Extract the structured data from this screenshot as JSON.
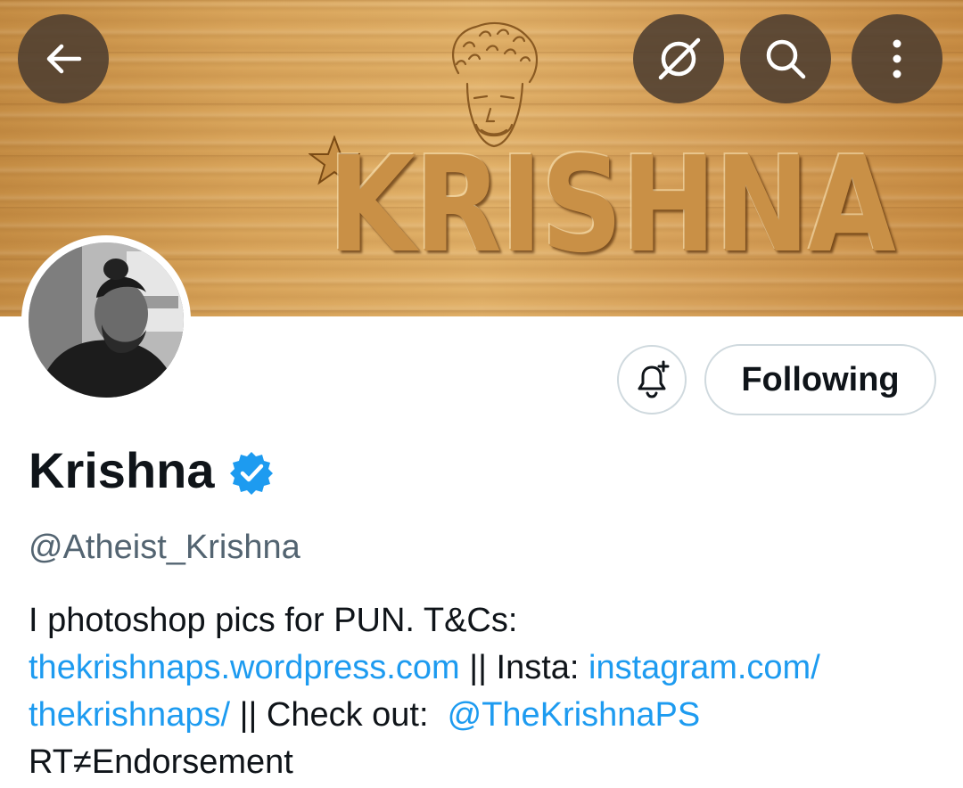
{
  "banner": {
    "word": "KRISHNA",
    "colors": {
      "wood_light": "#e2b26a",
      "wood_dark": "#c58d44"
    }
  },
  "top_buttons": [
    {
      "name": "back-arrow-icon"
    },
    {
      "name": "grok-icon"
    },
    {
      "name": "search-icon"
    },
    {
      "name": "more-vertical-icon"
    }
  ],
  "actions": {
    "notifications_icon": "bell-plus-icon",
    "following_label": "Following"
  },
  "profile": {
    "display_name": "Krishna",
    "verified": true,
    "verified_color": "#1d9bf0",
    "handle": "@Atheist_Krishna"
  },
  "bio": {
    "line1": "I photoshop pics for PUN. T&Cs:",
    "link1": "thekrishnaps.wordpress.com",
    "sep1": " || Insta: ",
    "link2_part1": "instagram.com/",
    "link2_part2": "thekrishnaps/",
    "sep2": " || Check out:  ",
    "mention": "@TheKrishnaPS",
    "line4": "RT≠Endorsement"
  },
  "colors": {
    "link": "#1d9bf0",
    "secondary_text": "#536471",
    "border": "#cfd9de",
    "overlay_button": "#4d3e30"
  }
}
